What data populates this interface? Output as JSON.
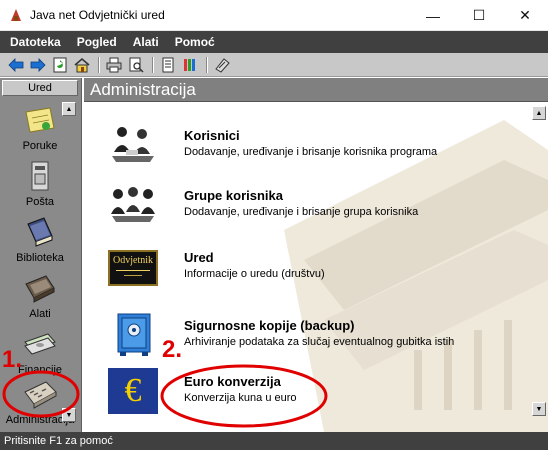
{
  "window": {
    "title": "Java net Odvjetnički ured",
    "minimize_glyph": "—",
    "maximize_glyph": "☐",
    "close_glyph": "✕"
  },
  "menu": {
    "items": [
      "Datoteka",
      "Pogled",
      "Alati",
      "Pomoć"
    ]
  },
  "toolbar": {
    "icons": [
      "back-arrow-icon",
      "forward-arrow-icon",
      "refresh-icon",
      "home-icon",
      "print-icon",
      "print-preview-icon",
      "document-icon",
      "pens-icon",
      "calculator-icon"
    ]
  },
  "sidebar": {
    "header": "Ured",
    "items": [
      {
        "label": "Poruke",
        "icon": "sticky-note-icon"
      },
      {
        "label": "Pošta",
        "icon": "mailbox-icon"
      },
      {
        "label": "Biblioteka",
        "icon": "book-icon"
      },
      {
        "label": "Alati",
        "icon": "toolbox-icon"
      },
      {
        "label": "Financije",
        "icon": "money-icon"
      },
      {
        "label": "Administracija",
        "icon": "mixer-console-icon"
      }
    ]
  },
  "content": {
    "header": "Administracija",
    "entries": [
      {
        "title": "Korisnici",
        "description": "Dodavanje, uređivanje i brisanje korisnika programa",
        "icon": "users-meeting-icon"
      },
      {
        "title": "Grupe korisnika",
        "description": "Dodavanje, uređivanje i brisanje grupa korisnika",
        "icon": "user-group-icon"
      },
      {
        "title": "Ured",
        "description": "Informacije o uredu (društvu)",
        "icon": "office-sign-icon",
        "icon_text": "Odvjetnik"
      },
      {
        "title": "Sigurnosne kopije (backup)",
        "description": "Arhiviranje podataka za slučaj eventualnog gubitka istih",
        "icon": "safe-icon"
      },
      {
        "title": "Euro konverzija",
        "description": "Konverzija kuna u euro",
        "icon": "euro-icon",
        "icon_text": "€"
      }
    ]
  },
  "status": {
    "text": "Pritisnite F1 za pomoć"
  },
  "annotations": {
    "step1": "1.",
    "step2": "2.",
    "color": "#e00000"
  },
  "colors": {
    "menubar": "#404040",
    "sidebar": "#8a8a8a",
    "content_header": "#808080",
    "annotation": "#e00000"
  }
}
